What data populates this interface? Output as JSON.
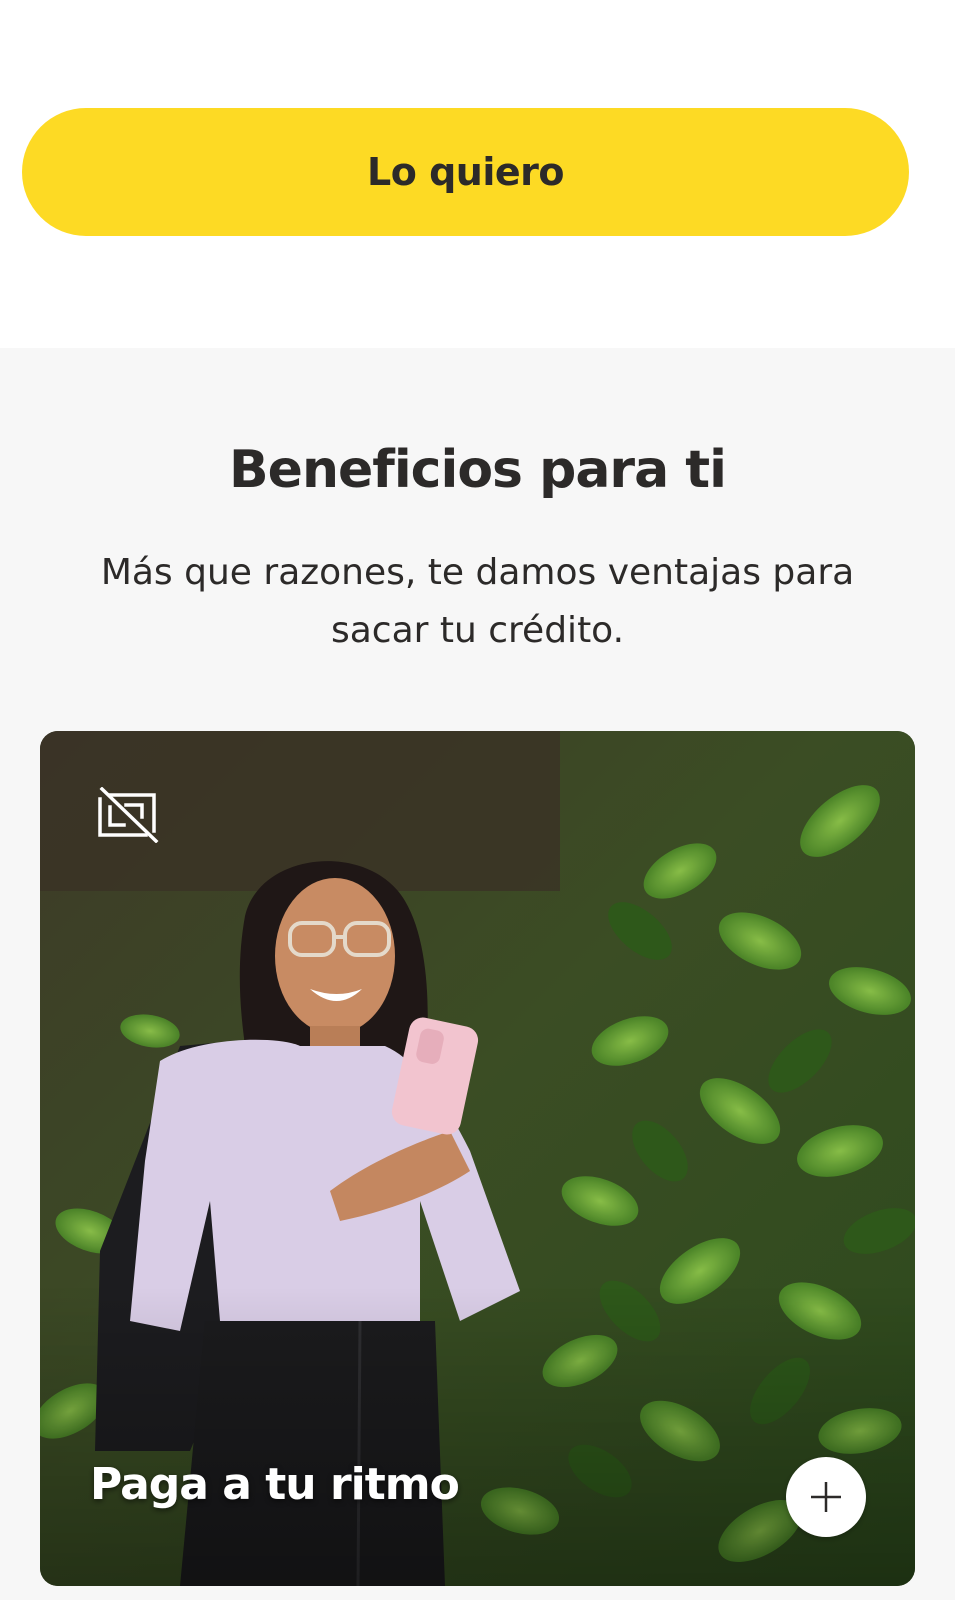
{
  "cta": {
    "label": "Lo quiero"
  },
  "benefits": {
    "title": "Beneficios para ti",
    "subtitle": "Más que razones, te damos ventajas para sacar tu crédito.",
    "card": {
      "title": "Paga a tu ritmo",
      "icons": {
        "media": "video-off-icon",
        "expand": "plus-icon"
      }
    }
  },
  "colors": {
    "accent": "#fdda24",
    "text": "#2c2a29",
    "section_bg": "#f7f7f7"
  }
}
